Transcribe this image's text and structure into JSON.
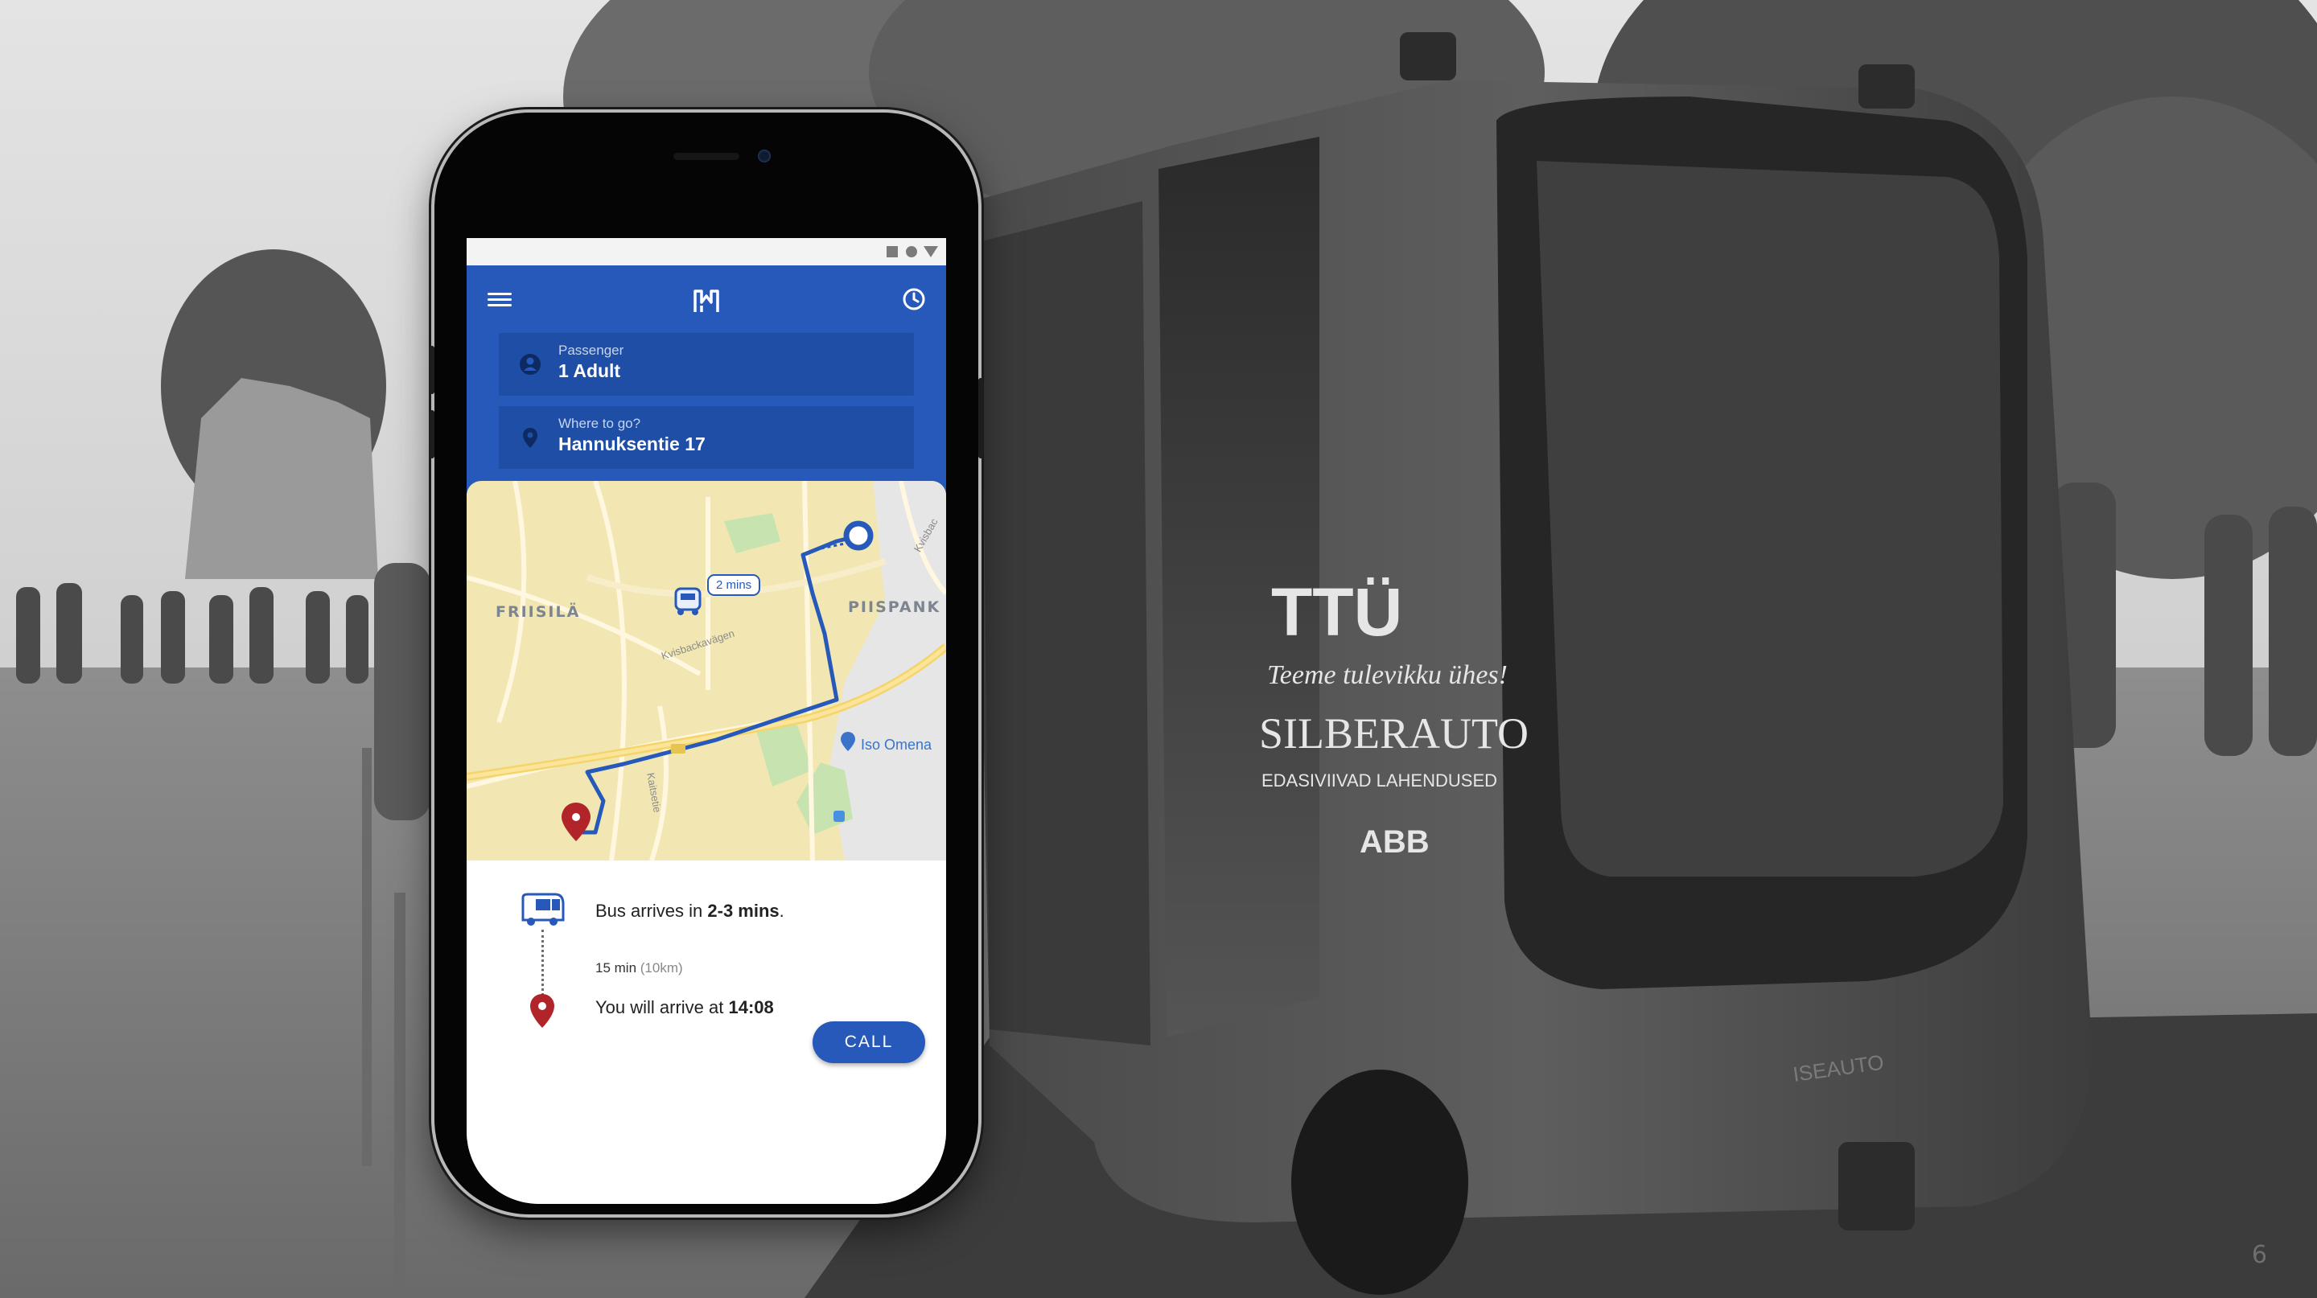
{
  "slide": {
    "number": "6"
  },
  "vehicle_branding": {
    "ttu": "TTÜ",
    "slogan": "Teeme tulevikku ühes!",
    "silberauto": "SILBERAUTO",
    "silberauto_sub": "EDASIVIIVAD LAHENDUSED",
    "abb": "ABB",
    "iseauto": "ISEAUTO"
  },
  "app": {
    "status_icons": [
      "square-icon",
      "circle-icon",
      "triangle-icon"
    ],
    "header": {
      "menu_icon": "hamburger-menu-icon",
      "logo_icon": "app-logo-icon",
      "history_icon": "clock-icon"
    },
    "passenger": {
      "label": "Passenger",
      "value": "1 Adult",
      "icon": "person-icon"
    },
    "destination": {
      "label": "Where to go?",
      "value": "Hannuksentie 17",
      "icon": "location-pin-icon"
    },
    "map": {
      "eta_chip": "2 mins",
      "areas": [
        "FRIISILÄ",
        "PIISPANK"
      ],
      "poi": "Iso Omena",
      "streets": [
        "Kvisbackavägen",
        "Kvisbac",
        "Kaitsetie"
      ],
      "route_color": "#2659ba",
      "destination_pin_color": "#b0242a"
    },
    "trip": {
      "arrival_prefix": "Bus arrives in ",
      "arrival_time": "2-3 mins",
      "arrival_suffix": ".",
      "duration": "15 min",
      "distance": "(10km)",
      "arrive_prefix": "You will arrive at ",
      "arrive_time": "14:08",
      "call_label": "CALL"
    },
    "colors": {
      "primary": "#2659ba",
      "primary_dark": "#1e4ea6",
      "pin": "#b0242a"
    }
  }
}
